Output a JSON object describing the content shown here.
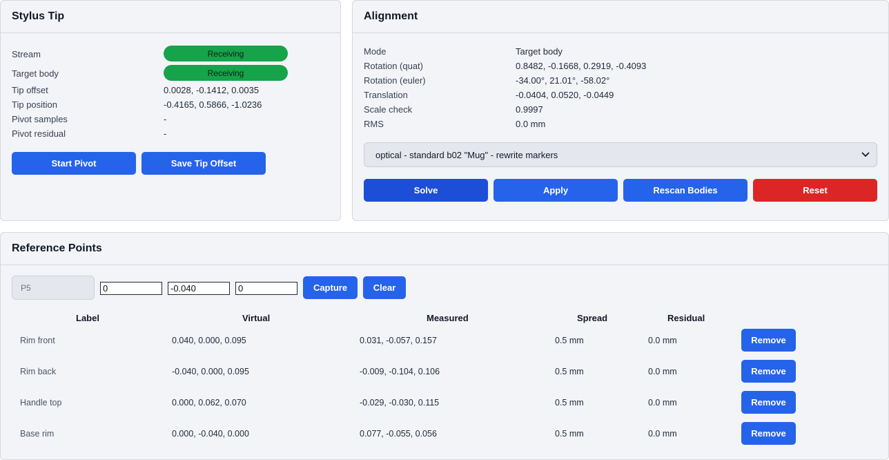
{
  "stylus": {
    "title": "Stylus Tip",
    "stream_label": "Stream",
    "stream_status": "Receiving",
    "target_label": "Target body",
    "target_status": "Receiving",
    "tip_offset_label": "Tip offset",
    "tip_offset": "0.0028, -0.1412, 0.0035",
    "tip_position_label": "Tip position",
    "tip_position": "-0.4165, 0.5866, -1.0236",
    "pivot_samples_label": "Pivot samples",
    "pivot_samples": "-",
    "pivot_residual_label": "Pivot residual",
    "pivot_residual": "-",
    "start_pivot": "Start Pivot",
    "save_tip_offset": "Save Tip Offset",
    "status_color": "#16a34a"
  },
  "alignment": {
    "title": "Alignment",
    "mode_label": "Mode",
    "mode": "Target body",
    "rot_quat_label": "Rotation (quat)",
    "rot_quat": "0.8482, -0.1668, 0.2919, -0.4093",
    "rot_euler_label": "Rotation (euler)",
    "rot_euler": "-34.00°, 21.01°, -58.02°",
    "translation_label": "Translation",
    "translation": "-0.0404, 0.0520, -0.0449",
    "scale_label": "Scale check",
    "scale": "0.9997",
    "rms_label": "RMS",
    "rms": "0.0 mm",
    "select_value": "optical - standard b02 \"Mug\" - rewrite markers",
    "solve": "Solve",
    "apply": "Apply",
    "rescan": "Rescan Bodies",
    "reset": "Reset",
    "accent_color": "#2563eb",
    "danger_color": "#dc2626"
  },
  "refs": {
    "title": "Reference Points",
    "label_placeholder": "P5",
    "x_value": "0",
    "y_value": "-0.040",
    "z_value": "0",
    "capture": "Capture",
    "clear": "Clear",
    "headers": {
      "label": "Label",
      "virtual": "Virtual",
      "measured": "Measured",
      "spread": "Spread",
      "residual": "Residual"
    },
    "rows": [
      {
        "label": "Rim front",
        "virtual": "0.040, 0.000, 0.095",
        "measured": "0.031, -0.057, 0.157",
        "spread": "0.5 mm",
        "residual": "0.0 mm",
        "action": "Remove"
      },
      {
        "label": "Rim back",
        "virtual": "-0.040, 0.000, 0.095",
        "measured": "-0.009, -0.104, 0.106",
        "spread": "0.5 mm",
        "residual": "0.0 mm",
        "action": "Remove"
      },
      {
        "label": "Handle top",
        "virtual": "0.000, 0.062, 0.070",
        "measured": "-0.029, -0.030, 0.115",
        "spread": "0.5 mm",
        "residual": "0.0 mm",
        "action": "Remove"
      },
      {
        "label": "Base rim",
        "virtual": "0.000, -0.040, 0.000",
        "measured": "0.077, -0.055, 0.056",
        "spread": "0.5 mm",
        "residual": "0.0 mm",
        "action": "Remove"
      }
    ]
  }
}
